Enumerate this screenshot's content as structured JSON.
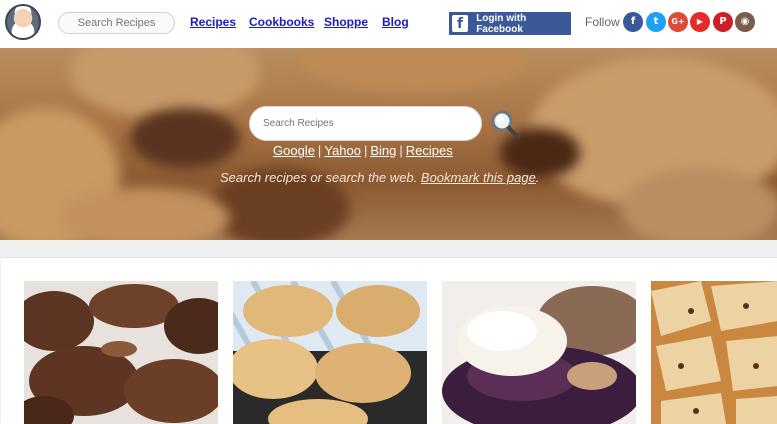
{
  "header": {
    "search_placeholder": "Search Recipes",
    "nav": [
      {
        "label": "Recipes"
      },
      {
        "label": "Cookbooks"
      },
      {
        "label": "Shoppe"
      },
      {
        "label": "Blog"
      }
    ],
    "facebook_button": "Login with Facebook",
    "follow_label": "Follow",
    "social": [
      {
        "icon": "facebook-icon",
        "glyph": "f",
        "color": "#3b5998"
      },
      {
        "icon": "twitter-icon",
        "glyph": "t",
        "color": "#1da1f2"
      },
      {
        "icon": "google-plus-icon",
        "glyph": "G+",
        "color": "#dd4b39"
      },
      {
        "icon": "youtube-icon",
        "glyph": "▶",
        "color": "#e52d27"
      },
      {
        "icon": "pinterest-icon",
        "glyph": "P",
        "color": "#cb2027"
      },
      {
        "icon": "instagram-icon",
        "glyph": "◉",
        "color": "#7a5c4a"
      }
    ]
  },
  "hero": {
    "search_placeholder": "Search Recipes",
    "engines": [
      "Google",
      "Yahoo",
      "Bing",
      "Recipes"
    ],
    "tagline_text": "Search recipes or search the web.",
    "bookmark_link": "Bookmark this page",
    "tagline_end": "."
  },
  "cards": [
    {
      "name": "chocolate-no-bake-cookies"
    },
    {
      "name": "oatmeal-cookies-on-rack"
    },
    {
      "name": "blueberry-cobbler-ice-cream"
    },
    {
      "name": "pie-crust-bars"
    }
  ]
}
